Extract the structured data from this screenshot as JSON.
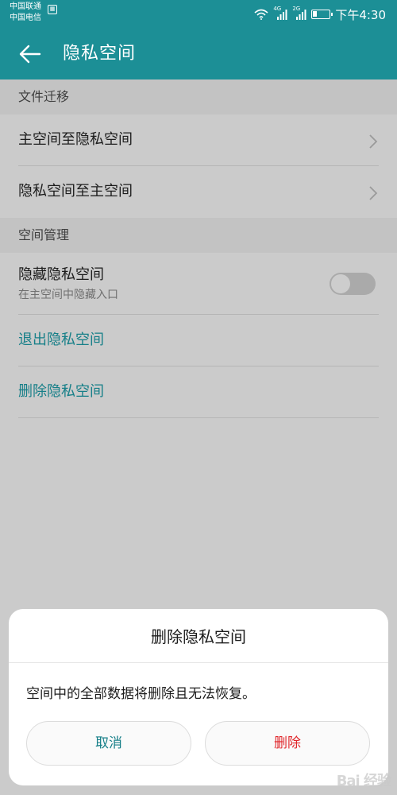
{
  "status_bar": {
    "carrier_1": "中国联通",
    "carrier_2": "中国电信",
    "signal_1_tag": "4G",
    "signal_2_tag": "2G",
    "time": "下午4:30",
    "icons": [
      "sim-icon",
      "wifi-icon",
      "signal-icon",
      "signal-icon",
      "battery-icon"
    ]
  },
  "app_bar": {
    "title": "隐私空间",
    "back_icon": "arrow-left-icon"
  },
  "sections": {
    "file_migration": {
      "header": "文件迁移",
      "items": [
        {
          "label": "主空间至隐私空间"
        },
        {
          "label": "隐私空间至主空间"
        }
      ]
    },
    "space_management": {
      "header": "空间管理",
      "hide_space": {
        "label": "隐藏隐私空间",
        "subtitle": "在主空间中隐藏入口",
        "toggle_on": false
      },
      "exit_label": "退出隐私空间",
      "delete_label": "删除隐私空间"
    }
  },
  "dialog": {
    "title": "删除隐私空间",
    "message": "空间中的全部数据将删除且无法恢复。",
    "cancel_label": "取消",
    "delete_label": "删除"
  },
  "watermark": "Bai 经验",
  "colors": {
    "primary": "#1c8f96",
    "link": "#167f88",
    "danger": "#e0262a",
    "scrim": "#cbcbcb"
  }
}
